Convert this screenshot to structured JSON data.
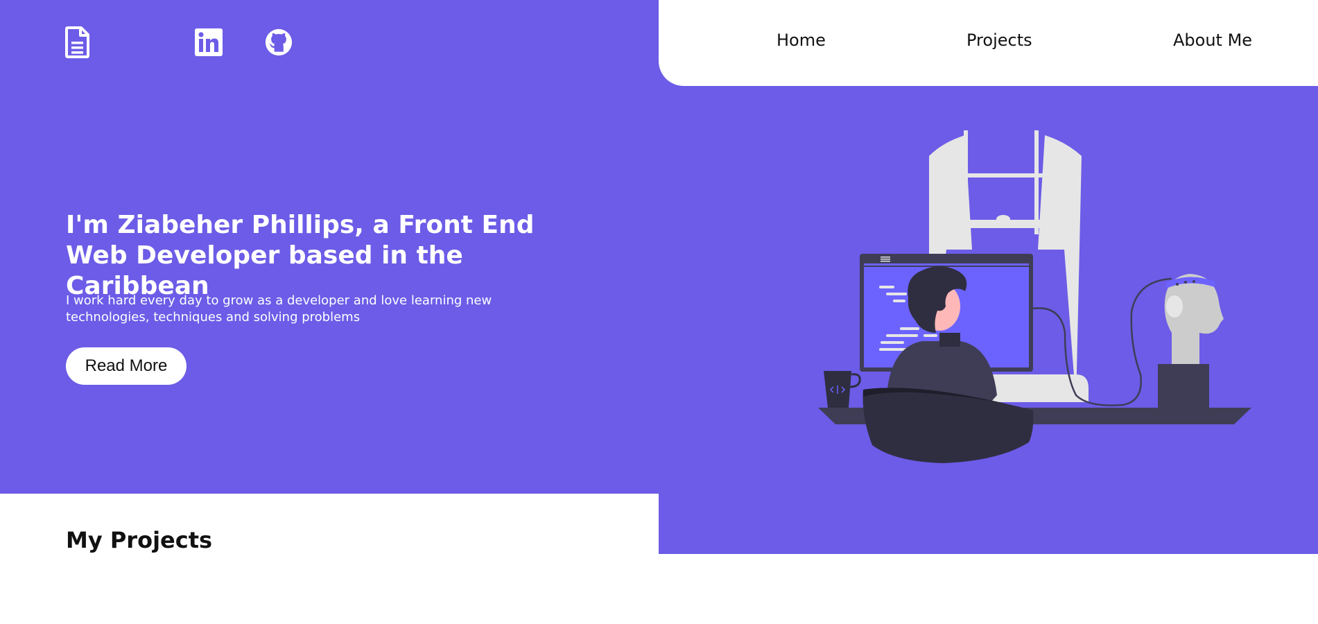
{
  "nav": {
    "items": [
      {
        "label": "Home"
      },
      {
        "label": "Projects"
      },
      {
        "label": "About Me"
      }
    ]
  },
  "social": {
    "icons": [
      "document-icon",
      "linkedin-icon",
      "github-icon"
    ]
  },
  "hero": {
    "title": "I'm Ziabeher Phillips, a Front End Web Developer based in the Caribbean",
    "subtitle": "I work hard every day to grow as a developer and love learning new technologies, techniques and solving problems",
    "button_label": "Read More"
  },
  "projects": {
    "title": "My Projects"
  },
  "colors": {
    "brand_purple": "#6c5ce7",
    "white": "#ffffff",
    "dark": "#2f2e41"
  }
}
